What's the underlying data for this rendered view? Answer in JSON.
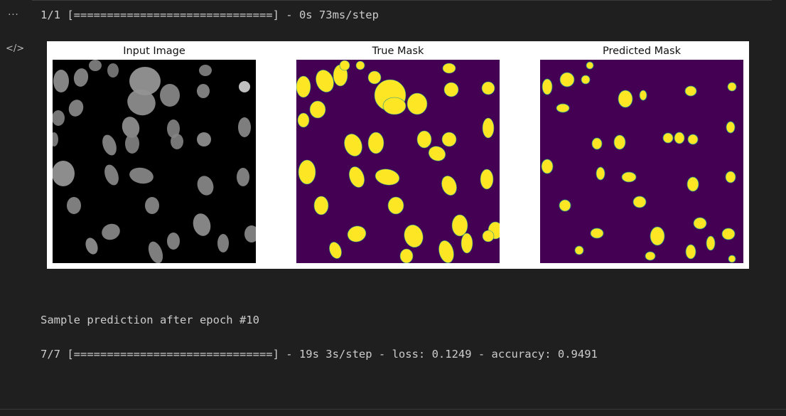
{
  "gutter": {
    "more_icon": "more-icon",
    "code_icon": "code-icon",
    "more_glyph": "···",
    "code_glyph": "</>"
  },
  "output": {
    "progress_line_1": "1/1 [==============================] - 0s 73ms/step",
    "sample_text": "Sample prediction after epoch #10",
    "epoch_line": "7/7 [==============================] - 19s 3s/step - loss: 0.1249 - accuracy: 0.9491"
  },
  "figure": {
    "panels": [
      {
        "title": "Input Image"
      },
      {
        "title": "True Mask"
      },
      {
        "title": "Predicted Mask"
      }
    ],
    "colors": {
      "input_bg": "#000000",
      "mask_bg": "#440154",
      "mask_fg": "#fde725",
      "mask_edge": "#21918c"
    }
  }
}
